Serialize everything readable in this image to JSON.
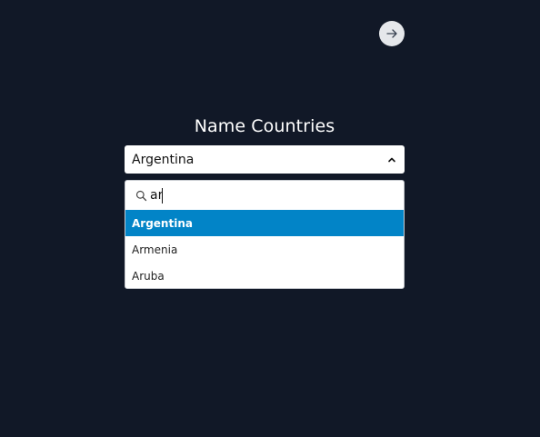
{
  "colors": {
    "background": "#111827",
    "accent": "#0284c7",
    "button_bg": "#e5e7eb"
  },
  "header": {
    "next_icon": "arrow-right-icon"
  },
  "main": {
    "title": "Name Countries",
    "select": {
      "value": "Argentina",
      "icon": "chevron-up-icon",
      "expanded": true
    },
    "dropdown": {
      "search": {
        "icon": "search-icon",
        "value": "ar"
      },
      "options": [
        {
          "label": "Argentina",
          "selected": true
        },
        {
          "label": "Armenia",
          "selected": false
        },
        {
          "label": "Aruba",
          "selected": false
        }
      ]
    }
  }
}
